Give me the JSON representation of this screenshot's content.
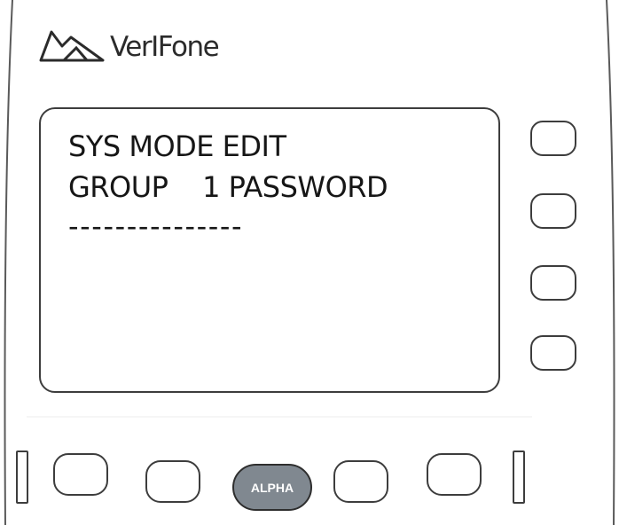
{
  "brand": {
    "name": "VerIFone"
  },
  "screen": {
    "lines": [
      "SYS MODE EDIT",
      "GROUP    1 PASSWORD",
      "---------------"
    ]
  },
  "keys": {
    "alpha_label": "ALPHA"
  }
}
